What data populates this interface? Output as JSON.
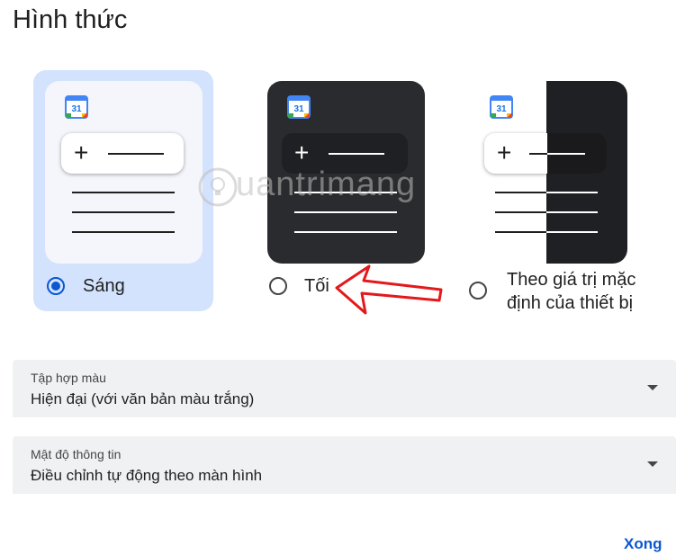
{
  "section_title": "Hình thức",
  "calendar_icon": {
    "name": "google-calendar-icon",
    "day": "31"
  },
  "themes": [
    {
      "label": "Sáng",
      "selected": true
    },
    {
      "label": "Tối",
      "selected": false
    },
    {
      "label": "Theo giá trị mặc định của thiết bị",
      "selected": false
    }
  ],
  "watermark": "uantrimang",
  "color_set": {
    "label": "Tập hợp màu",
    "value": "Hiện đại (với văn bản màu trắng)"
  },
  "density": {
    "label": "Mật độ thông tin",
    "value": "Điều chỉnh tự động theo màn hình"
  },
  "done_label": "Xong",
  "colors": {
    "accent": "#0b57d0",
    "selected_bg": "#d3e3fd",
    "annotation_arrow": "#e3191c"
  }
}
